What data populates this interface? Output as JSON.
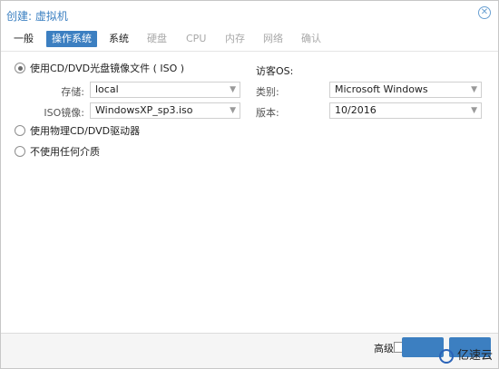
{
  "window": {
    "title": "创建: 虚拟机",
    "close_icon": "close-icon"
  },
  "tabs": [
    {
      "label": "一般",
      "state": "normal"
    },
    {
      "label": "操作系统",
      "state": "active"
    },
    {
      "label": "系统",
      "state": "normal"
    },
    {
      "label": "硬盘",
      "state": "disabled"
    },
    {
      "label": "CPU",
      "state": "disabled"
    },
    {
      "label": "内存",
      "state": "disabled"
    },
    {
      "label": "网络",
      "state": "disabled"
    },
    {
      "label": "确认",
      "state": "disabled"
    }
  ],
  "media": {
    "option_iso": "使用CD/DVD光盘镜像文件 ( ISO )",
    "storage_label": "存储:",
    "storage_value": "local",
    "iso_label": "ISO镜像:",
    "iso_value": "WindowsXP_sp3.iso",
    "option_physical": "使用物理CD/DVD驱动器",
    "option_none": "不使用任何介质"
  },
  "guest_os": {
    "heading": "访客OS:",
    "type_label": "类别:",
    "type_value": "Microsoft Windows",
    "version_label": "版本:",
    "version_value": "10/2016"
  },
  "footer": {
    "advanced_label": "高级",
    "back_label": "",
    "next_label": "",
    "watermark_text": "亿速云"
  },
  "colors": {
    "accent": "#3c7fc1",
    "title": "#3a7fc1"
  }
}
